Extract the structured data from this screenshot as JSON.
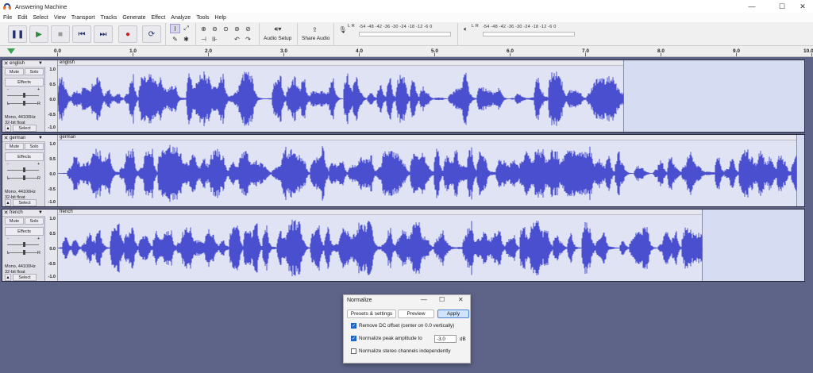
{
  "window": {
    "title": "Answering Machine",
    "minimize": "—",
    "maximize": "☐",
    "close": "✕"
  },
  "menu": [
    "File",
    "Edit",
    "Select",
    "View",
    "Transport",
    "Tracks",
    "Generate",
    "Effect",
    "Analyze",
    "Tools",
    "Help"
  ],
  "toolbar": {
    "pause": "❚❚",
    "play": "▶",
    "stop": "■",
    "skip_start": "⏮",
    "skip_end": "⏭",
    "record": "●",
    "loop": "⟳",
    "audio_setup": "Audio Setup",
    "share_audio": "Share Audio",
    "rec_meter_scale": "-54 -48 -42 -36 -30 -24 -18 -12 -6 0",
    "play_meter_scale": "-54 -48 -42 -36 -30 -24 -18 -12 -6 0",
    "lr_label": "L R"
  },
  "ruler": {
    "ticks": [
      "0.0",
      "1.0",
      "2.0",
      "3.0",
      "4.0",
      "5.0",
      "6.0",
      "7.0",
      "8.0",
      "9.0",
      "10.0"
    ]
  },
  "tracks": [
    {
      "name": "english",
      "clip_name": "english",
      "mute": "Mute",
      "solo": "Solo",
      "effects": "Effects",
      "rate": "Mono, 44100Hz",
      "format": "32-bit float",
      "select": "Select",
      "scale": [
        "1.0",
        "0.5",
        "0.0",
        "-0.5",
        "-1.0"
      ],
      "gain_minus": "-",
      "gain_plus": "+",
      "pan_l": "L",
      "pan_r": "R"
    },
    {
      "name": "german",
      "clip_name": "german",
      "mute": "Mute",
      "solo": "Solo",
      "effects": "Effects",
      "rate": "Mono, 44100Hz",
      "format": "32-bit float",
      "select": "Select",
      "scale": [
        "1.0",
        "0.5",
        "0.0",
        "-0.5",
        "-1.0"
      ],
      "gain_minus": "-",
      "gain_plus": "+",
      "pan_l": "L",
      "pan_r": "R"
    },
    {
      "name": "french",
      "clip_name": "french",
      "mute": "Mute",
      "solo": "Solo",
      "effects": "Effects",
      "rate": "Mono, 44100Hz",
      "format": "32-bit float",
      "select": "Select",
      "scale": [
        "1.0",
        "0.5",
        "0.0",
        "-0.5",
        "-1.0"
      ],
      "gain_minus": "-",
      "gain_plus": "+",
      "pan_l": "L",
      "pan_r": "R"
    }
  ],
  "dialog": {
    "title": "Normalize",
    "presets": "Presets & settings",
    "preview": "Preview",
    "apply": "Apply",
    "remove_dc": "Remove DC offset (center on 0.0 vertically)",
    "remove_dc_checked": true,
    "normalize_peak": "Normalize peak amplitude to",
    "normalize_peak_checked": true,
    "peak_value": "-3.0",
    "peak_unit": "dB",
    "stereo_independent": "Normalize stereo channels independently",
    "stereo_independent_checked": false
  },
  "colors": {
    "wave": "#4a4fd0",
    "wave_light": "#7b80e6",
    "clip_bg": "#dfe3f4",
    "background": "#5e6388"
  }
}
